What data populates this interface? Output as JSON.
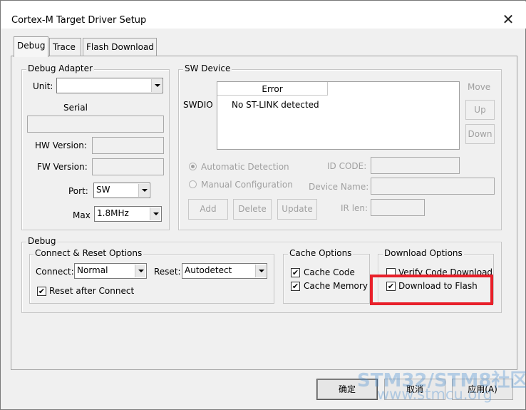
{
  "window": {
    "title": "Cortex-M Target Driver Setup"
  },
  "tabs": [
    {
      "label": "Debug",
      "active": true
    },
    {
      "label": "Trace",
      "active": false
    },
    {
      "label": "Flash Download",
      "active": false
    }
  ],
  "debug_adapter": {
    "legend": "Debug Adapter",
    "unit_label": "Unit:",
    "unit_value": "",
    "serial_label": "Serial",
    "serial_value": "",
    "hw_version_label": "HW Version:",
    "hw_version_value": "",
    "fw_version_label": "FW Version:",
    "fw_version_value": "",
    "port_label": "Port:",
    "port_value": "SW",
    "max_label": "Max",
    "max_value": "1.8MHz"
  },
  "sw_device": {
    "legend": "SW Device",
    "row_label": "SWDIO",
    "column_header": "Error",
    "status_text": "No ST-LINK detected",
    "move_label": "Move",
    "up_button": "Up",
    "down_button": "Down",
    "auto_detection_label": "Automatic Detection",
    "manual_config_label": "Manual Configuration",
    "id_code_label": "ID CODE:",
    "device_name_label": "Device Name:",
    "ir_len_label": "IR len:",
    "add_button": "Add",
    "delete_button": "Delete",
    "update_button": "Update"
  },
  "debug": {
    "legend": "Debug",
    "connect_reset": {
      "legend": "Connect & Reset Options",
      "connect_label": "Connect:",
      "connect_value": "Normal",
      "reset_label": "Reset:",
      "reset_value": "Autodetect",
      "reset_after_connect_label": "Reset after Connect",
      "reset_after_connect_checked": true
    },
    "cache_options": {
      "legend": "Cache Options",
      "cache_code_label": "Cache Code",
      "cache_code_checked": true,
      "cache_memory_label": "Cache Memory",
      "cache_memory_checked": true
    },
    "download_options": {
      "legend": "Download Options",
      "verify_label": "Verify Code Download",
      "verify_checked": false,
      "download_flash_label": "Download to Flash",
      "download_flash_checked": true
    }
  },
  "footer": {
    "ok_button": "确定",
    "cancel_button": "取消",
    "apply_button": "应用(A)"
  },
  "watermark": {
    "line1": "STM32/STM8社区",
    "line2": "www.stmcu.org"
  },
  "colors": {
    "highlight": "#e8202a",
    "watermark": "#468cd2"
  },
  "icons": {
    "close": "close-icon",
    "dropdown": "chevron-down-icon",
    "check": "checkmark-icon"
  }
}
